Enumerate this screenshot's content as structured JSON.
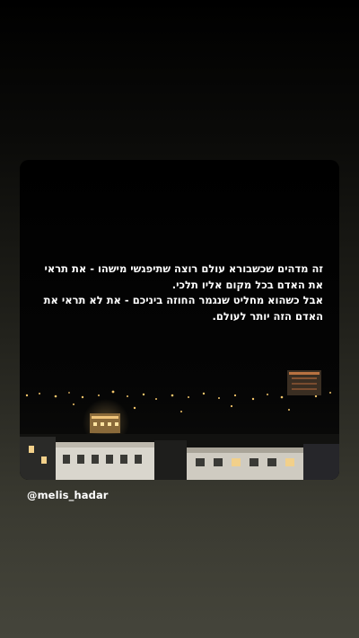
{
  "post": {
    "quote_line_1": "זה מדהים שכשבורא עולם רוצה שתיפגשי מישהו - את תראי את האדם בכל מקום אליו תלכי.",
    "quote_line_2": "אבל כשהוא מחליט שנגמר החוזה ביניכם - את לא תראי את האדם הזה יותר לעולם."
  },
  "mention": {
    "handle": "@melis_hadar"
  },
  "colors": {
    "background_top": "#000000",
    "background_bottom": "#45453b",
    "text": "#ffffff"
  }
}
